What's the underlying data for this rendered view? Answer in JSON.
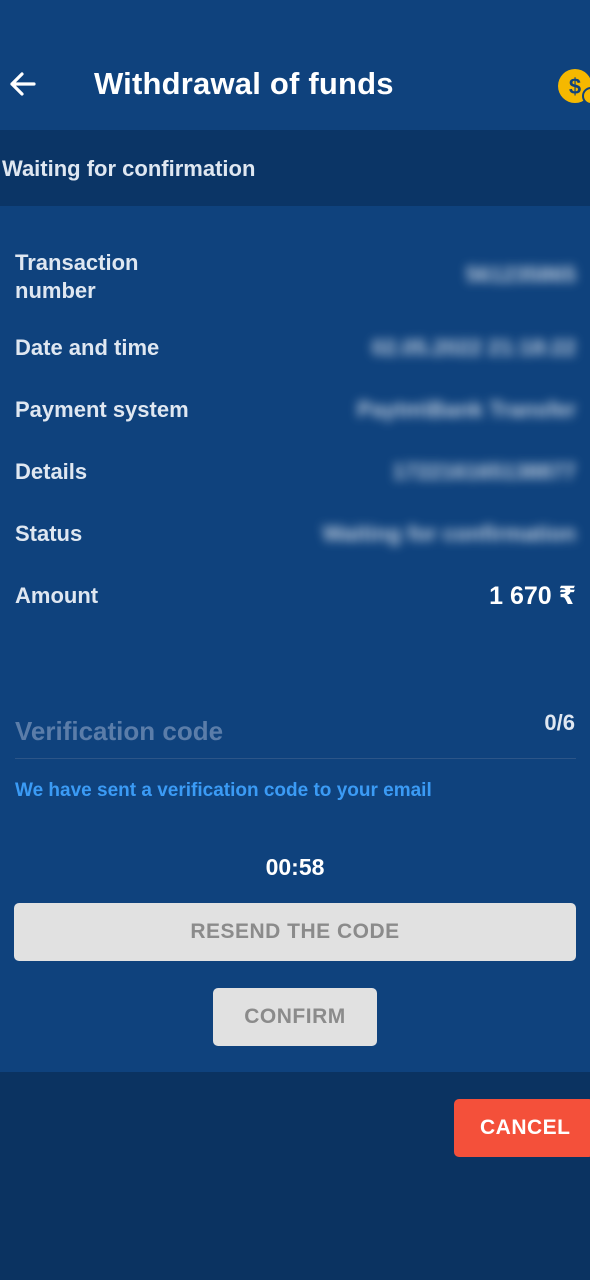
{
  "header": {
    "title": "Withdrawal of funds",
    "back_icon": "arrow-left-icon",
    "wallet_icon": "dollar-coin-icon"
  },
  "banner": {
    "text": "Waiting for confirmation"
  },
  "details": {
    "transaction_number": {
      "label": "Transaction\nnumber",
      "value": "561235865"
    },
    "date_time": {
      "label": "Date and time",
      "value": "02.05.2022 21:18:22"
    },
    "payment_system": {
      "label": "Payment system",
      "value": "Paytm\\Bank Transfer"
    },
    "details": {
      "label": "Details",
      "value": "172216165138877"
    },
    "status": {
      "label": "Status",
      "value": "Waiting for confirmation"
    },
    "amount": {
      "label": "Amount",
      "value": "1 670 ₹"
    }
  },
  "verification": {
    "placeholder": "Verification code",
    "counter": "0/6",
    "hint": "We have sent a verification code to your email",
    "timer": "00:58"
  },
  "buttons": {
    "resend": "RESEND THE CODE",
    "confirm": "CONFIRM",
    "cancel": "CANCEL"
  },
  "colors": {
    "background": "#0f427d",
    "banner": "#0b3566",
    "hint": "#3b9bf5",
    "cancel": "#f4503a",
    "coin": "#f5b800"
  }
}
